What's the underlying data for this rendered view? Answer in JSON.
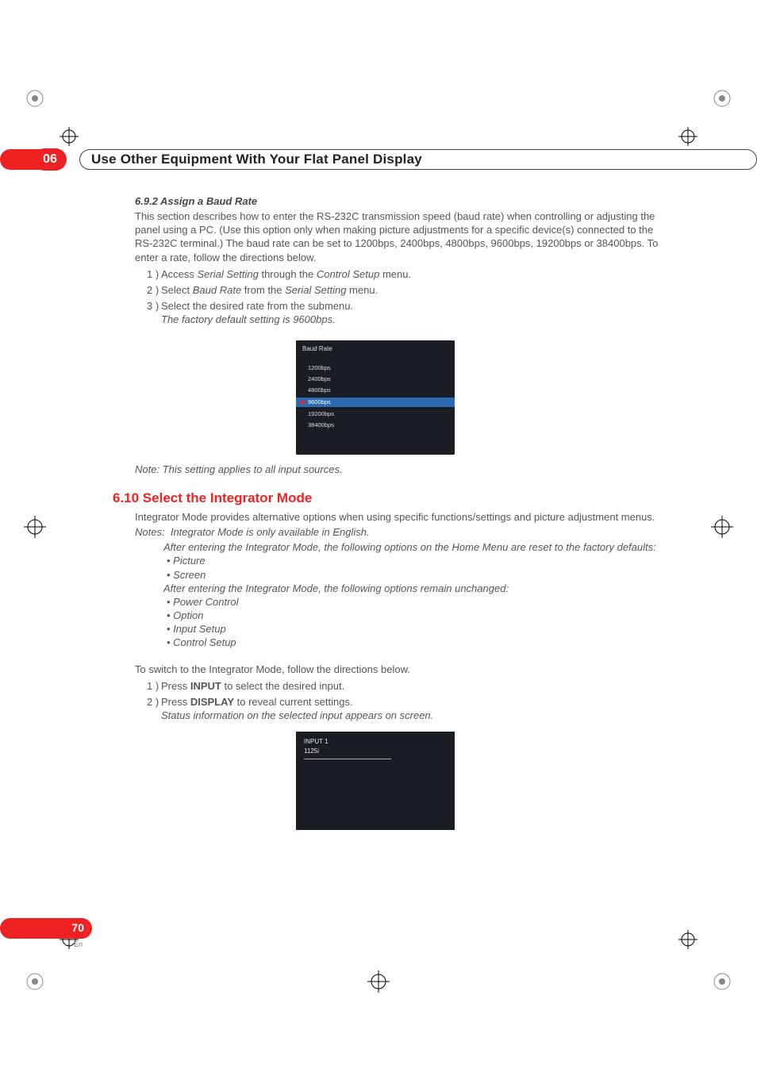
{
  "chapter": {
    "num": "06",
    "title": "Use Other Equipment With Your Flat Panel Display"
  },
  "s692": {
    "heading": "6.9.2   Assign a Baud Rate",
    "intro": "This section describes how to enter the RS-232C transmission speed (baud rate) when controlling or adjusting the panel using a PC. (Use this option only when making picture adjustments for a specific device(s) connected to the RS-232C terminal.) The baud rate can be set to 1200bps, 2400bps, 4800bps, 9600bps, 19200bps or 38400bps. To enter a rate, follow the directions below.",
    "steps": [
      {
        "n": "1 )",
        "pre": "Access ",
        "em1": "Serial Setting",
        "mid": " through the ",
        "em2": "Control Setup",
        "post": " menu."
      },
      {
        "n": "2 )",
        "pre": "Select ",
        "em1": "Baud Rate",
        "mid": " from the ",
        "em2": "Serial Setting",
        "post": " menu."
      },
      {
        "n": "3 )",
        "pre": "Select the desired rate from the submenu.",
        "em1": "",
        "mid": "",
        "em2": "",
        "post": ""
      }
    ],
    "step3_note": "The factory default setting is 9600bps.",
    "menu": {
      "title": "Baud Rate",
      "options": [
        "1200bps",
        "2400bps",
        "4800bps",
        "9600bps",
        "19200bps",
        "38400bps"
      ],
      "selected_index": 3
    },
    "footnote": "Note: This setting applies to all input sources."
  },
  "s610": {
    "heading": "6.10 Select the Integrator Mode",
    "intro": "Integrator Mode provides alternative options when using specific functions/settings and picture adjustment menus.",
    "notes_label": "Notes:",
    "note1": "Integrator Mode is only available in English.",
    "note2": "After entering the Integrator Mode, the following options on the Home Menu are reset to the factory defaults:",
    "reset_items": [
      "Picture",
      "Screen"
    ],
    "note3": "After entering the Integrator Mode, the following options remain unchanged:",
    "keep_items": [
      "Power Control",
      "Option",
      "Input Setup",
      "Control Setup"
    ],
    "switch_intro": "To switch to the Integrator Mode, follow the directions below.",
    "steps": [
      {
        "n": "1 )",
        "a": "Press ",
        "b": "INPUT",
        "c": " to select the desired input."
      },
      {
        "n": "2 )",
        "a": "Press ",
        "b": "DISPLAY",
        "c": " to reveal current settings."
      }
    ],
    "step2_note": "Status information on the selected input appears on screen.",
    "osd": {
      "top": "INPUT 1",
      "res": "1125i"
    }
  },
  "page": {
    "num": "70",
    "lang": "En"
  }
}
